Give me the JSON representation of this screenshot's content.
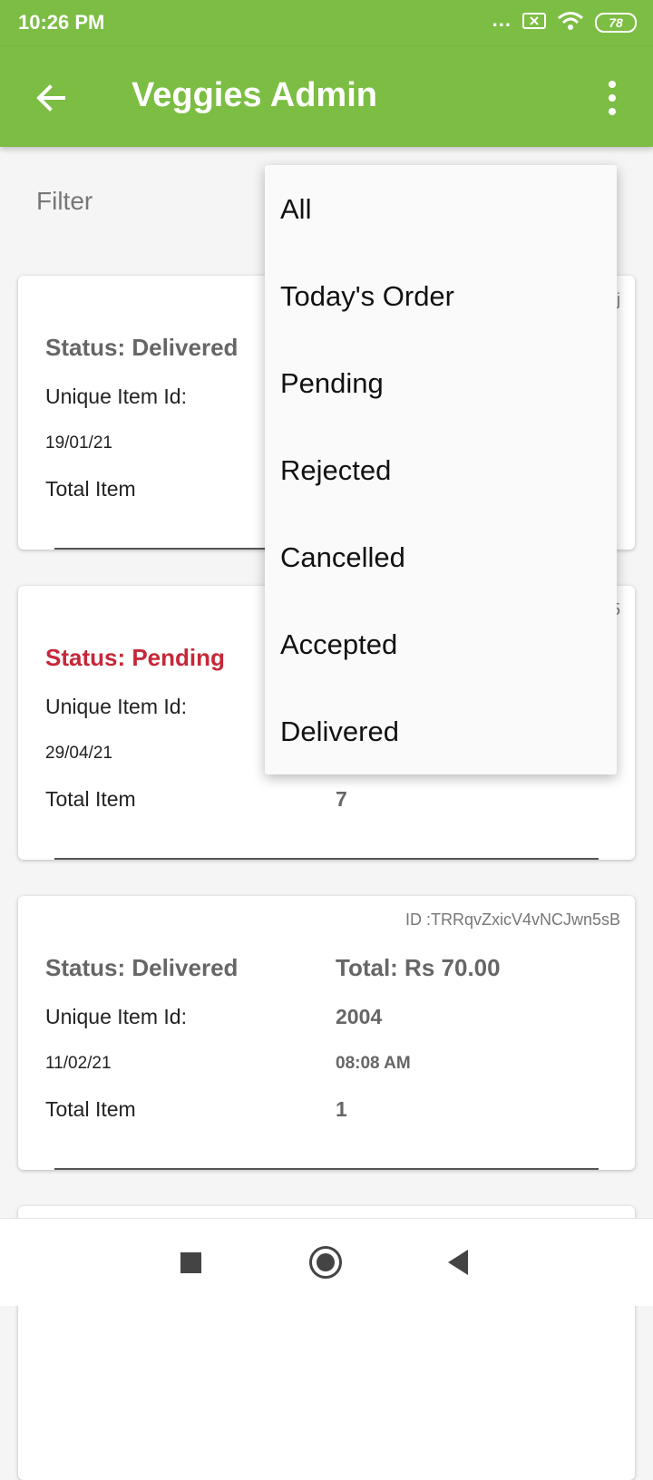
{
  "status_bar": {
    "time": "10:26 PM",
    "dots": "...",
    "battery": "78"
  },
  "app_bar": {
    "title": "Veggies Admin",
    "back_icon": "arrow-back-icon",
    "menu_icon": "more-vert-icon"
  },
  "filter": {
    "label": "Filter"
  },
  "dropdown": {
    "options": [
      "All",
      "Today's Order",
      "Pending",
      "Rejected",
      "Cancelled",
      "Accepted",
      "Delivered"
    ]
  },
  "orders": [
    {
      "id_fragment": "j",
      "status": "Status: Delivered",
      "uid_label": "Unique Item Id:",
      "date": "19/01/21",
      "items_label": "Total Item"
    },
    {
      "id_fragment": "5",
      "status": "Status: Pending",
      "uid_label": "Unique Item Id:",
      "date": "29/04/21",
      "items_label": "Total Item",
      "items_value": "7"
    },
    {
      "id": "ID :TRRqvZxicV4vNCJwn5sB",
      "status": "Status: Delivered",
      "total": "Total: Rs 70.00",
      "uid_label": "Unique Item Id:",
      "uid_value": "2004",
      "date": "11/02/21",
      "time": "08:08 AM",
      "items_label": "Total Item",
      "items_value": "1"
    }
  ],
  "colors": {
    "primary": "#7cbd43",
    "pending": "#c62839"
  }
}
